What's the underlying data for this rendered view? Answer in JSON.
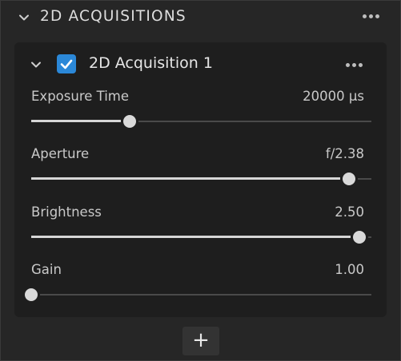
{
  "section": {
    "title": "2D ACQUISITIONS"
  },
  "acquisition": {
    "title": "2D Acquisition 1",
    "enabled": true,
    "parameters": [
      {
        "label": "Exposure Time",
        "value": "20000 µs",
        "fraction": 0.29
      },
      {
        "label": "Aperture",
        "value": "f/2.38",
        "fraction": 0.935
      },
      {
        "label": "Brightness",
        "value": "2.50",
        "fraction": 0.965
      },
      {
        "label": "Gain",
        "value": "1.00",
        "fraction": 0.0
      }
    ]
  },
  "add_button": {
    "symbol": "+"
  },
  "colors": {
    "accent": "#2b88d8",
    "background": "#262626",
    "card": "#1e1e1e",
    "slider_fill": "#d6d6d6",
    "slider_track": "#4a4a4a"
  },
  "icons": {
    "section_collapse": "chevron-down-icon",
    "section_menu": "more-dots-icon",
    "card_collapse": "chevron-down-icon",
    "card_enabled": "checkbox-checked-icon",
    "card_menu": "more-dots-icon",
    "add": "plus-icon"
  }
}
